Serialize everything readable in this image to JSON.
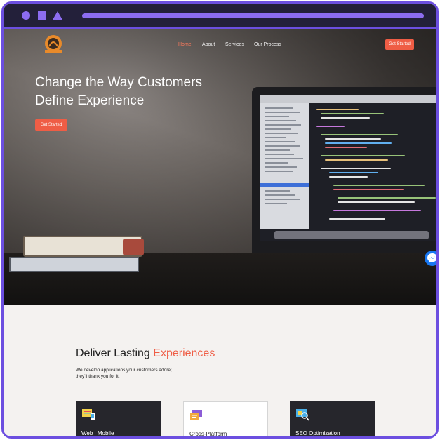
{
  "browser": {},
  "nav": {
    "items": [
      "Home",
      "About",
      "Services",
      "Our Process"
    ],
    "cta": "Get Started"
  },
  "hero": {
    "title_line1": "Change the Way Customers",
    "title_line2_a": "Define ",
    "title_line2_b": "Experience",
    "button": "Get Started"
  },
  "section": {
    "title_a": "Deliver Lasting ",
    "title_b": "Experiences",
    "sub_line1": "We develop applications your customers adore;",
    "sub_line2": "they'll thank you for it."
  },
  "cards": [
    {
      "label": "Web | Mobile",
      "icon": "web-mobile-icon"
    },
    {
      "label": "Cross-Platform",
      "icon": "cross-platform-icon"
    },
    {
      "label": "SEO Optimization",
      "icon": "seo-icon"
    }
  ],
  "colors": {
    "accent": "#ef5d45",
    "frame": "#6c4fe0",
    "card_dark": "#26262c"
  }
}
